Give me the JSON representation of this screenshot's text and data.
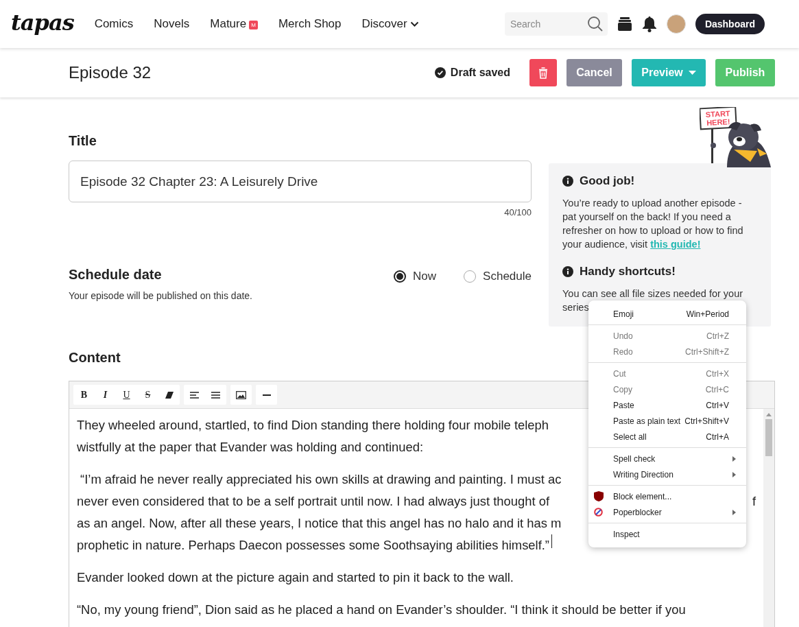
{
  "nav": {
    "logo": "tapas",
    "links": [
      {
        "label": "Comics"
      },
      {
        "label": "Novels"
      },
      {
        "label": "Mature",
        "badge": "M"
      },
      {
        "label": "Merch Shop"
      },
      {
        "label": "Discover",
        "dropdown": true
      }
    ],
    "search": {
      "placeholder": "Search"
    },
    "dashboard": "Dashboard"
  },
  "header": {
    "title": "Episode 32",
    "status": "Draft saved",
    "buttons": [
      {
        "kind": "delete"
      },
      {
        "kind": "cancel",
        "label": "Cancel"
      },
      {
        "kind": "preview",
        "label": "Preview"
      },
      {
        "kind": "publish",
        "label": "Publish"
      }
    ]
  },
  "title_field": {
    "label": "Title",
    "value": "Episode 32 Chapter 23: A Leisurely Drive",
    "counter": "40/100"
  },
  "schedule": {
    "label": "Schedule date",
    "hint": "Your episode will be published on this date.",
    "options": [
      {
        "label": "Now",
        "selected": true
      },
      {
        "label": "Schedule",
        "selected": false
      }
    ]
  },
  "sidebar": {
    "mascot_sign": "START HERE!",
    "sections": [
      {
        "heading": "Good job!",
        "body": "You’re ready to upload another episode - pat yourself on the back! If you need a refresher on how to upload or how to find your audience, visit",
        "link": "this guide!"
      },
      {
        "heading": "Handy shortcuts!",
        "lines": [
          "You can see all file sizes needed for your",
          "series"
        ]
      }
    ]
  },
  "content": {
    "label": "Content",
    "toolbar": [
      [
        {
          "kind": "bold",
          "glyph": "B"
        },
        {
          "kind": "italic",
          "glyph": "I"
        },
        {
          "kind": "underline",
          "glyph": "U"
        },
        {
          "kind": "strike",
          "glyph": "S"
        },
        {
          "kind": "eraser"
        }
      ],
      [
        {
          "kind": "align-left"
        },
        {
          "kind": "justify"
        }
      ],
      [
        {
          "kind": "image"
        }
      ],
      [
        {
          "kind": "rule"
        }
      ]
    ],
    "paragraphs": [
      {
        "lines": [
          {
            "text": "They wheeled around, startled, to find Dion standing there holding four mobile teleph"
          },
          {
            "text": "wistfully at the paper that Evander was holding and continued:"
          }
        ]
      },
      {
        "lines": [
          {
            "text": " “I’m afraid he never really appreciated his own skills at drawing and painting. I must ac"
          },
          {
            "text": "never even considered that to be a self portrait until now. I had always just thought of",
            "tail": "f"
          },
          {
            "text": "as an angel. Now, after all these years, I notice that this angel has no halo and it has m"
          },
          {
            "text": "prophetic in nature. Perhaps Daecon possesses some Soothsaying abilities himself.”",
            "cursor": true
          }
        ]
      },
      {
        "lines": [
          {
            "text": "Evander looked down at the picture again and started to pin it back to the wall."
          }
        ]
      },
      {
        "lines": [
          {
            "text": "“No, my young friend”, Dion said as he placed a hand on Evander’s shoulder. “I think it should be better if you"
          }
        ]
      }
    ]
  },
  "context_menu": {
    "groups": [
      [
        {
          "kind": "plain",
          "label": "Emoji",
          "shortcut": "Win+Period",
          "disabled": false,
          "submenu": false
        }
      ],
      [
        {
          "kind": "plain",
          "label": "Undo",
          "shortcut": "Ctrl+Z",
          "disabled": true,
          "submenu": false
        },
        {
          "kind": "plain",
          "label": "Redo",
          "shortcut": "Ctrl+Shift+Z",
          "disabled": true,
          "submenu": false
        }
      ],
      [
        {
          "kind": "plain",
          "label": "Cut",
          "shortcut": "Ctrl+X",
          "disabled": true,
          "submenu": false
        },
        {
          "kind": "plain",
          "label": "Copy",
          "shortcut": "Ctrl+C",
          "disabled": true,
          "submenu": false
        },
        {
          "kind": "plain",
          "label": "Paste",
          "shortcut": "Ctrl+V",
          "disabled": false,
          "submenu": false
        },
        {
          "kind": "plain",
          "label": "Paste as plain text",
          "shortcut": "Ctrl+Shift+V",
          "disabled": false,
          "submenu": false
        },
        {
          "kind": "plain",
          "label": "Select all",
          "shortcut": "Ctrl+A",
          "disabled": false,
          "submenu": false
        }
      ],
      [
        {
          "kind": "plain",
          "label": "Spell check",
          "disabled": false,
          "submenu": true
        },
        {
          "kind": "plain",
          "label": "Writing Direction",
          "disabled": false,
          "submenu": true
        }
      ],
      [
        {
          "kind": "shield",
          "label": "Block element...",
          "disabled": false,
          "submenu": false
        },
        {
          "kind": "blocked",
          "label": "Poperblocker",
          "disabled": false,
          "submenu": true
        }
      ],
      [
        {
          "kind": "plain",
          "label": "Inspect",
          "disabled": false,
          "submenu": false
        }
      ]
    ]
  }
}
